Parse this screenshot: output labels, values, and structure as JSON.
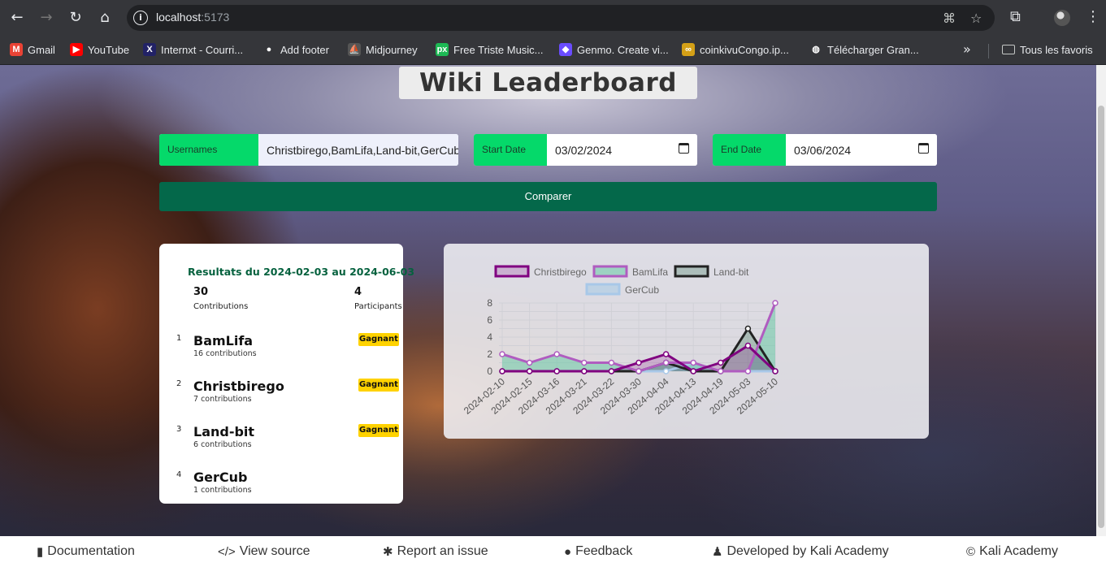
{
  "browser": {
    "url_host": "localhost",
    "url_port": ":5173",
    "bookmarks": [
      {
        "label": "Gmail",
        "icon": "gmail-icon",
        "color": "#ea4335",
        "glyph": "M"
      },
      {
        "label": "YouTube",
        "icon": "youtube-icon",
        "color": "#ff0000",
        "glyph": "▶"
      },
      {
        "label": "Internxt - Courri...",
        "icon": "internxt-icon",
        "color": "#222266",
        "glyph": "X"
      },
      {
        "label": "Add footer",
        "icon": "github-icon",
        "color": "#35363a",
        "glyph": "●"
      },
      {
        "label": "Midjourney",
        "icon": "midjourney-icon",
        "color": "#555555",
        "glyph": "⛵"
      },
      {
        "label": "Free Triste Music...",
        "icon": "pixabay-icon",
        "color": "#1db954",
        "glyph": "px"
      },
      {
        "label": "Genmo. Create vi...",
        "icon": "genmo-icon",
        "color": "#6a4cff",
        "glyph": "◆"
      },
      {
        "label": "coinkivuCongo.ip...",
        "icon": "coin-icon",
        "color": "#d4a017",
        "glyph": "∞"
      },
      {
        "label": "Télécharger Gran...",
        "icon": "globe-icon",
        "color": "#35363a",
        "glyph": "◍"
      }
    ],
    "all_bookmarks_label": "Tous les favoris"
  },
  "page": {
    "title": "Wiki Leaderboard",
    "form": {
      "usernames_label": "Usernames",
      "usernames_value": "Christbirego,BamLifa,Land-bit,GerCub",
      "start_label": "Start Date",
      "start_value": "03/02/2024",
      "end_label": "End Date",
      "end_value": "03/06/2024",
      "compare_label": "Comparer"
    },
    "results": {
      "heading": "Resultats du 2024-02-03 au 2024-06-03",
      "contributions_count": "30",
      "contributions_label": "Contributions",
      "participants_count": "4",
      "participants_label": "Participants",
      "users": [
        {
          "rank": "1",
          "name": "BamLifa",
          "contrib": "16 contributions",
          "badge": "Gagnant"
        },
        {
          "rank": "2",
          "name": "Christbirego",
          "contrib": "7 contributions",
          "badge": "Gagnant"
        },
        {
          "rank": "3",
          "name": "Land-bit",
          "contrib": "6 contributions",
          "badge": "Gagnant"
        },
        {
          "rank": "4",
          "name": "GerCub",
          "contrib": "1 contributions",
          "badge": ""
        }
      ]
    }
  },
  "chart_data": {
    "type": "line",
    "categories": [
      "2024-02-10",
      "2024-02-15",
      "2024-03-16",
      "2024-03-21",
      "2024-03-22",
      "2024-03-30",
      "2024-04-04",
      "2024-04-13",
      "2024-04-19",
      "2024-05-03",
      "2024-05-10"
    ],
    "ylim": [
      0,
      8
    ],
    "yticks": [
      "8",
      "6",
      "4",
      "2",
      "0"
    ],
    "grid": true,
    "legend_position": "top",
    "series": [
      {
        "name": "Christbirego",
        "stroke": "#800080",
        "fill": "rgba(128,0,128,0.2)",
        "values": [
          0,
          0,
          0,
          0,
          0,
          1,
          2,
          0,
          1,
          3,
          0
        ]
      },
      {
        "name": "BamLifa",
        "stroke": "#b05cc0",
        "fill": "rgba(94,200,160,0.5)",
        "values": [
          2,
          1,
          2,
          1,
          1,
          0,
          1,
          1,
          0,
          0,
          8
        ]
      },
      {
        "name": "Land-bit",
        "stroke": "#222222",
        "fill": "rgba(60,120,90,0.3)",
        "values": [
          0,
          0,
          0,
          0,
          0,
          0,
          1,
          0,
          0,
          5,
          0
        ]
      },
      {
        "name": "GerCub",
        "stroke": "#a8c8e8",
        "fill": "rgba(160,200,230,0.5)",
        "values": [
          0,
          0,
          0,
          0,
          0,
          0,
          0,
          1,
          0,
          0,
          0
        ]
      }
    ]
  },
  "footer": {
    "items": [
      {
        "label": "Documentation",
        "icon": "book-icon",
        "glyph": "▮"
      },
      {
        "label": "View source",
        "icon": "code-icon",
        "glyph": "</>"
      },
      {
        "label": "Report an issue",
        "icon": "bug-icon",
        "glyph": "✱"
      },
      {
        "label": "Feedback",
        "icon": "comment-icon",
        "glyph": "●"
      },
      {
        "label": "Developed by Kali Academy",
        "icon": "users-icon",
        "glyph": "♟"
      },
      {
        "label": "Kali Academy",
        "icon": "copyright-icon",
        "glyph": "©"
      }
    ]
  }
}
